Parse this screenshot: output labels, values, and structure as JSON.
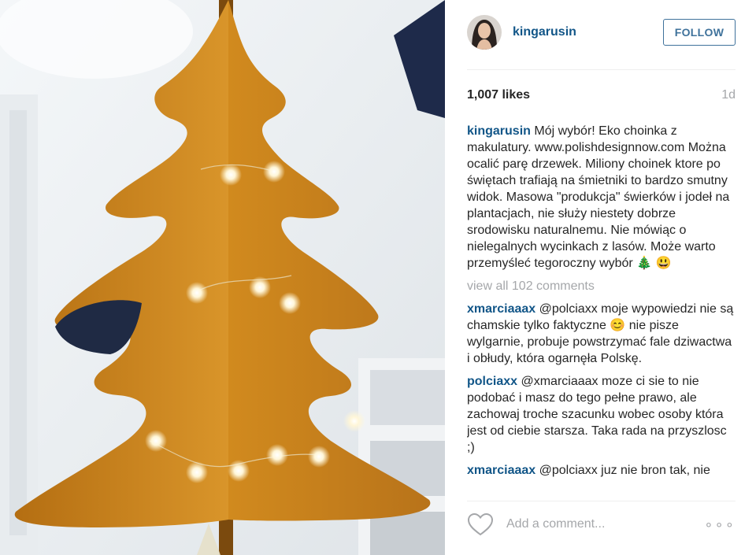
{
  "post": {
    "username": "kingarusin",
    "follow_label": "FOLLOW",
    "likes": "1,007 likes",
    "age": "1d"
  },
  "caption": {
    "user": "kingarusin",
    "text": "Mój wybór! Eko choinka z makulatury. www.polishdesignnow.com Można ocalić parę drzewek. Miliony choinek ktore po świętach trafiają na śmietniki to bardzo smutny widok. Masowa \"produkcja\" świerków i jodeł na plantacjach, nie służy niestety dobrze srodowisku naturalnemu. Nie mówiąc o nielegalnych wycinkach z lasów. Może warto przemyśleć tegoroczny wybór 🎄 😃"
  },
  "view_all": "view all 102 comments",
  "comments": [
    {
      "user": "xmarciaaax",
      "text": "@polciaxx moje wypowiedzi nie są chamskie tylko faktyczne 😊 nie pisze wylgarnie, probuje powstrzymać fale dziwactwa i obłudy, która ogarnęła Polskę."
    },
    {
      "user": "polciaxx",
      "text": "@xmarciaaax moze ci sie to nie podobać i masz do tego pełne prawo, ale zachowaj troche szacunku wobec osoby która jest od ciebie starsza. Taka rada na przyszlosc ;)"
    },
    {
      "user": "xmarciaaax",
      "text": "@polciaxx juz nie bron tak, nie"
    }
  ],
  "footer": {
    "add_comment_placeholder": "Add a comment...",
    "more_label": "∘∘∘"
  },
  "icons": {
    "heart": "heart-icon",
    "more": "more-options-icon"
  },
  "colors": {
    "username": "#125688",
    "follow": "#3f729b",
    "muted": "#a5a7aa",
    "tree": "#c9861a"
  }
}
